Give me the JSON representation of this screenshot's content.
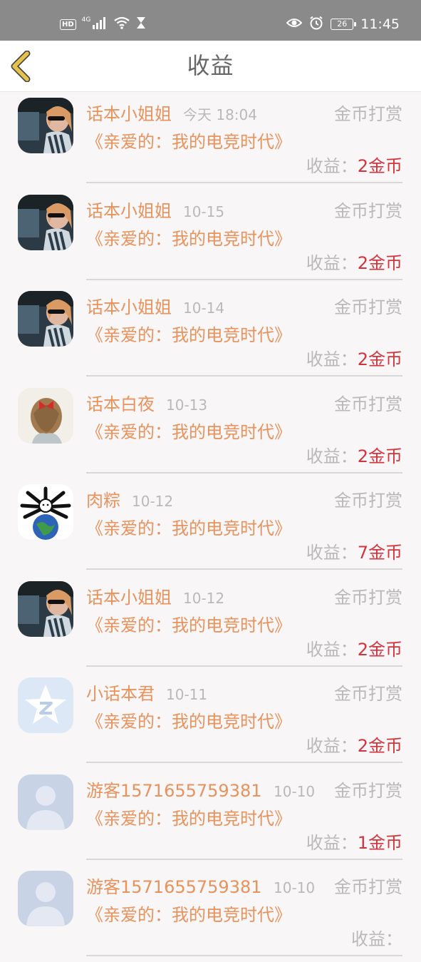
{
  "status_bar": {
    "hd": "HD",
    "signal_type": "4G",
    "battery": "26",
    "time": "11:45",
    "icons": [
      "hd-icon",
      "signal-icon",
      "wifi-icon",
      "hourglass-icon",
      "eye-icon",
      "alarm-icon",
      "battery-icon"
    ]
  },
  "header": {
    "title": "收益",
    "back_icon": "chevron-left-icon",
    "back_color": "#e6c24a"
  },
  "colors": {
    "name": "#e8925c",
    "muted": "#b9b9b9",
    "amount": "#d2343e"
  },
  "items": [
    {
      "name": "话本小姐姐",
      "date": "今天 18:04",
      "type": "金币打赏",
      "book": "《亲爱的：我的电竞时代》",
      "earn_label": "收益：",
      "earn_value": "2金币",
      "avatar": "photo-girl"
    },
    {
      "name": "话本小姐姐",
      "date": "10-15",
      "type": "金币打赏",
      "book": "《亲爱的：我的电竞时代》",
      "earn_label": "收益：",
      "earn_value": "2金币",
      "avatar": "photo-girl"
    },
    {
      "name": "话本小姐姐",
      "date": "10-14",
      "type": "金币打赏",
      "book": "《亲爱的：我的电竞时代》",
      "earn_label": "收益：",
      "earn_value": "2金币",
      "avatar": "photo-girl"
    },
    {
      "name": "话本白夜",
      "date": "10-13",
      "type": "金币打赏",
      "book": "《亲爱的：我的电竞时代》",
      "earn_label": "收益：",
      "earn_value": "2金币",
      "avatar": "photo-hair-bow"
    },
    {
      "name": "肉粽",
      "date": "10-12",
      "type": "金币打赏",
      "book": "《亲爱的：我的电竞时代》",
      "earn_label": "收益：",
      "earn_value": "7金币",
      "avatar": "globe-bones"
    },
    {
      "name": "话本小姐姐",
      "date": "10-12",
      "type": "金币打赏",
      "book": "《亲爱的：我的电竞时代》",
      "earn_label": "收益：",
      "earn_value": "2金币",
      "avatar": "photo-girl"
    },
    {
      "name": "小话本君",
      "date": "10-11",
      "type": "金币打赏",
      "book": "《亲爱的：我的电竞时代》",
      "earn_label": "收益：",
      "earn_value": "2金币",
      "avatar": "star-logo"
    },
    {
      "name": "游客1571655759381",
      "date": "10-10",
      "type": "金币打赏",
      "book": "《亲爱的：我的电竞时代》",
      "earn_label": "收益：",
      "earn_value": "1金币",
      "avatar": "default-user"
    },
    {
      "name": "游客1571655759381",
      "date": "10-10",
      "type": "金币打赏",
      "book": "《亲爱的：我的电竞时代》",
      "earn_label": "收益：",
      "earn_value": "",
      "avatar": "default-user"
    }
  ]
}
